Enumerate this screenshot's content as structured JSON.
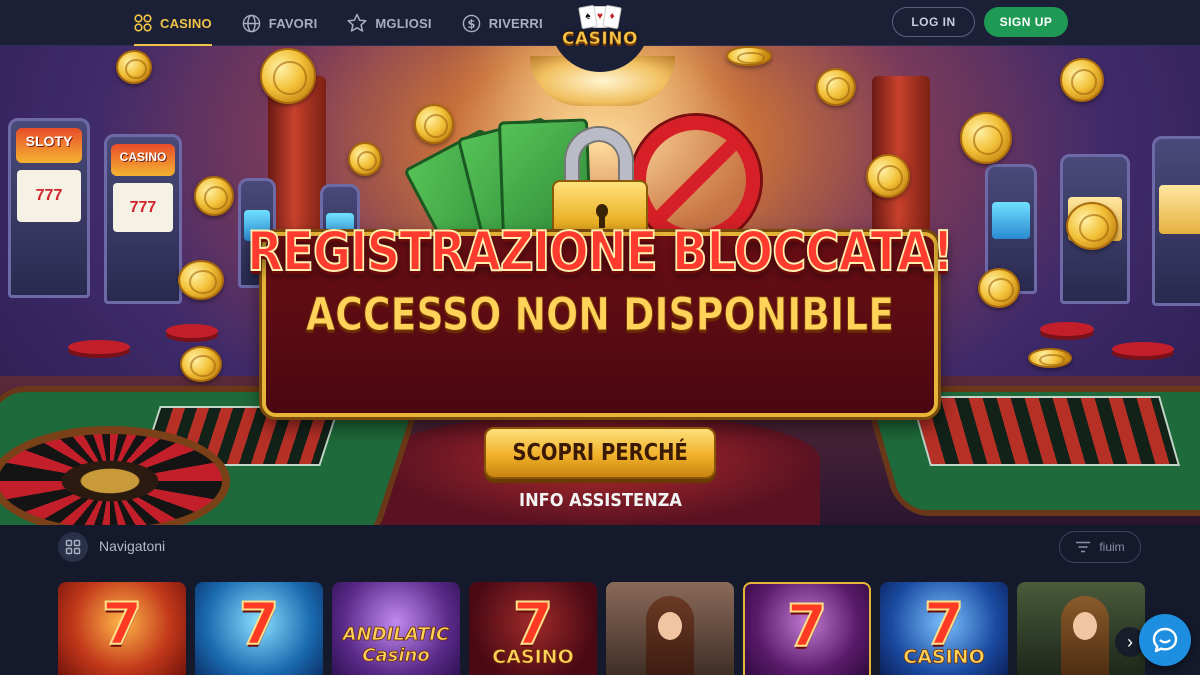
{
  "header": {
    "nav": [
      {
        "label": "CASINO",
        "icon": "grid-icon",
        "active": true
      },
      {
        "label": "FAVORI",
        "icon": "globe-icon",
        "active": false
      },
      {
        "label": "MGLIOSI",
        "icon": "star-icon",
        "active": false
      },
      {
        "label": "RIVERRI",
        "icon": "dollar-coin-icon",
        "active": false
      }
    ],
    "logo_text": "CASINO",
    "login_label": "LOG IN",
    "signup_label": "SIGN UP"
  },
  "hero": {
    "slot_signs": [
      "SLOTY",
      "CASINO"
    ],
    "slot_reels": [
      "777",
      "777"
    ],
    "title": "REGISTRAZIONE BLOCCATA!",
    "subtitle": "ACCESSO NON DISPONIBILE",
    "cta_label": "SCOPRI PERCHÉ",
    "help_link": "INFO ASSISTENZA"
  },
  "section": {
    "title": "Navigatoni",
    "filter_label": "fiuim",
    "tiles": [
      {
        "big": "7",
        "label": "",
        "bg": "#8a1010"
      },
      {
        "big": "7",
        "label": "",
        "bg": "#1a6ab0"
      },
      {
        "big": "",
        "label": "ANDILATIC Casino",
        "bg": "#5a2a8a"
      },
      {
        "big": "7",
        "label": "CASINO",
        "bg": "#4a0a14"
      },
      {
        "big": "",
        "label": "",
        "bg": "#5a3a2a"
      },
      {
        "big": "7",
        "label": "",
        "bg": "#5a1a6a"
      },
      {
        "big": "7",
        "label": "CASINO",
        "bg": "#1a4aa0"
      },
      {
        "big": "",
        "label": "",
        "bg": "#2a3a2a"
      }
    ]
  },
  "colors": {
    "accent": "#f0c447",
    "signup": "#1f9a55",
    "chat": "#1e8fe0"
  }
}
